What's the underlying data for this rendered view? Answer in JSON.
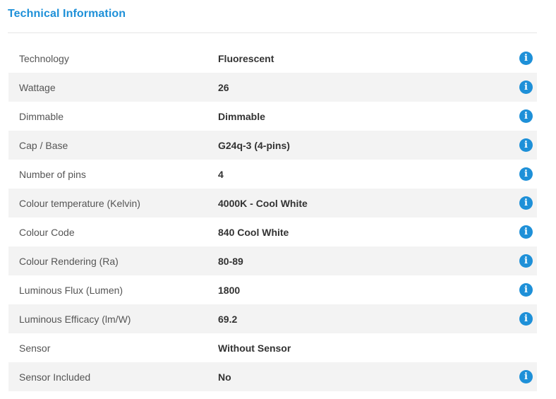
{
  "section": {
    "title": "Technical Information"
  },
  "specs": [
    {
      "label": "Technology",
      "value": "Fluorescent",
      "info": true,
      "info_glyph": "i"
    },
    {
      "label": "Wattage",
      "value": "26",
      "info": true,
      "info_glyph": "i"
    },
    {
      "label": "Dimmable",
      "value": "Dimmable",
      "info": true,
      "info_glyph": "i"
    },
    {
      "label": "Cap / Base",
      "value": "G24q-3 (4-pins)",
      "info": true,
      "info_glyph": "i"
    },
    {
      "label": "Number of pins",
      "value": "4",
      "info": true,
      "info_glyph": "i"
    },
    {
      "label": "Colour temperature (Kelvin)",
      "value": "4000K - Cool White",
      "info": true,
      "info_glyph": "i"
    },
    {
      "label": "Colour Code",
      "value": "840 Cool White",
      "info": true,
      "info_glyph": "i"
    },
    {
      "label": "Colour Rendering (Ra)",
      "value": "80-89",
      "info": true,
      "info_glyph": "i"
    },
    {
      "label": "Luminous Flux (Lumen)",
      "value": "1800",
      "info": true,
      "info_glyph": "i"
    },
    {
      "label": "Luminous Efficacy (lm/W)",
      "value": "69.2",
      "info": true,
      "info_glyph": "i"
    },
    {
      "label": "Sensor",
      "value": "Without Sensor",
      "info": false
    },
    {
      "label": "Sensor Included",
      "value": "No",
      "info": true,
      "info_glyph": "i"
    }
  ],
  "colors": {
    "accent": "#1e90d8",
    "row_shade": "#f3f3f3",
    "divider": "#e6e6e6"
  },
  "icons": {
    "info": "info-circle-icon"
  }
}
